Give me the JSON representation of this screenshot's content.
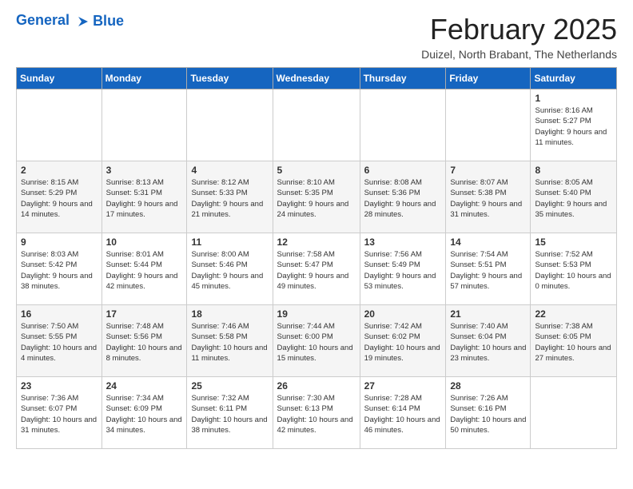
{
  "header": {
    "logo_line1": "General",
    "logo_line2": "Blue",
    "month_title": "February 2025",
    "location": "Duizel, North Brabant, The Netherlands"
  },
  "weekdays": [
    "Sunday",
    "Monday",
    "Tuesday",
    "Wednesday",
    "Thursday",
    "Friday",
    "Saturday"
  ],
  "weeks": [
    [
      {
        "num": "",
        "info": ""
      },
      {
        "num": "",
        "info": ""
      },
      {
        "num": "",
        "info": ""
      },
      {
        "num": "",
        "info": ""
      },
      {
        "num": "",
        "info": ""
      },
      {
        "num": "",
        "info": ""
      },
      {
        "num": "1",
        "info": "Sunrise: 8:16 AM\nSunset: 5:27 PM\nDaylight: 9 hours and 11 minutes."
      }
    ],
    [
      {
        "num": "2",
        "info": "Sunrise: 8:15 AM\nSunset: 5:29 PM\nDaylight: 9 hours and 14 minutes."
      },
      {
        "num": "3",
        "info": "Sunrise: 8:13 AM\nSunset: 5:31 PM\nDaylight: 9 hours and 17 minutes."
      },
      {
        "num": "4",
        "info": "Sunrise: 8:12 AM\nSunset: 5:33 PM\nDaylight: 9 hours and 21 minutes."
      },
      {
        "num": "5",
        "info": "Sunrise: 8:10 AM\nSunset: 5:35 PM\nDaylight: 9 hours and 24 minutes."
      },
      {
        "num": "6",
        "info": "Sunrise: 8:08 AM\nSunset: 5:36 PM\nDaylight: 9 hours and 28 minutes."
      },
      {
        "num": "7",
        "info": "Sunrise: 8:07 AM\nSunset: 5:38 PM\nDaylight: 9 hours and 31 minutes."
      },
      {
        "num": "8",
        "info": "Sunrise: 8:05 AM\nSunset: 5:40 PM\nDaylight: 9 hours and 35 minutes."
      }
    ],
    [
      {
        "num": "9",
        "info": "Sunrise: 8:03 AM\nSunset: 5:42 PM\nDaylight: 9 hours and 38 minutes."
      },
      {
        "num": "10",
        "info": "Sunrise: 8:01 AM\nSunset: 5:44 PM\nDaylight: 9 hours and 42 minutes."
      },
      {
        "num": "11",
        "info": "Sunrise: 8:00 AM\nSunset: 5:46 PM\nDaylight: 9 hours and 45 minutes."
      },
      {
        "num": "12",
        "info": "Sunrise: 7:58 AM\nSunset: 5:47 PM\nDaylight: 9 hours and 49 minutes."
      },
      {
        "num": "13",
        "info": "Sunrise: 7:56 AM\nSunset: 5:49 PM\nDaylight: 9 hours and 53 minutes."
      },
      {
        "num": "14",
        "info": "Sunrise: 7:54 AM\nSunset: 5:51 PM\nDaylight: 9 hours and 57 minutes."
      },
      {
        "num": "15",
        "info": "Sunrise: 7:52 AM\nSunset: 5:53 PM\nDaylight: 10 hours and 0 minutes."
      }
    ],
    [
      {
        "num": "16",
        "info": "Sunrise: 7:50 AM\nSunset: 5:55 PM\nDaylight: 10 hours and 4 minutes."
      },
      {
        "num": "17",
        "info": "Sunrise: 7:48 AM\nSunset: 5:56 PM\nDaylight: 10 hours and 8 minutes."
      },
      {
        "num": "18",
        "info": "Sunrise: 7:46 AM\nSunset: 5:58 PM\nDaylight: 10 hours and 11 minutes."
      },
      {
        "num": "19",
        "info": "Sunrise: 7:44 AM\nSunset: 6:00 PM\nDaylight: 10 hours and 15 minutes."
      },
      {
        "num": "20",
        "info": "Sunrise: 7:42 AM\nSunset: 6:02 PM\nDaylight: 10 hours and 19 minutes."
      },
      {
        "num": "21",
        "info": "Sunrise: 7:40 AM\nSunset: 6:04 PM\nDaylight: 10 hours and 23 minutes."
      },
      {
        "num": "22",
        "info": "Sunrise: 7:38 AM\nSunset: 6:05 PM\nDaylight: 10 hours and 27 minutes."
      }
    ],
    [
      {
        "num": "23",
        "info": "Sunrise: 7:36 AM\nSunset: 6:07 PM\nDaylight: 10 hours and 31 minutes."
      },
      {
        "num": "24",
        "info": "Sunrise: 7:34 AM\nSunset: 6:09 PM\nDaylight: 10 hours and 34 minutes."
      },
      {
        "num": "25",
        "info": "Sunrise: 7:32 AM\nSunset: 6:11 PM\nDaylight: 10 hours and 38 minutes."
      },
      {
        "num": "26",
        "info": "Sunrise: 7:30 AM\nSunset: 6:13 PM\nDaylight: 10 hours and 42 minutes."
      },
      {
        "num": "27",
        "info": "Sunrise: 7:28 AM\nSunset: 6:14 PM\nDaylight: 10 hours and 46 minutes."
      },
      {
        "num": "28",
        "info": "Sunrise: 7:26 AM\nSunset: 6:16 PM\nDaylight: 10 hours and 50 minutes."
      },
      {
        "num": "",
        "info": ""
      }
    ]
  ]
}
